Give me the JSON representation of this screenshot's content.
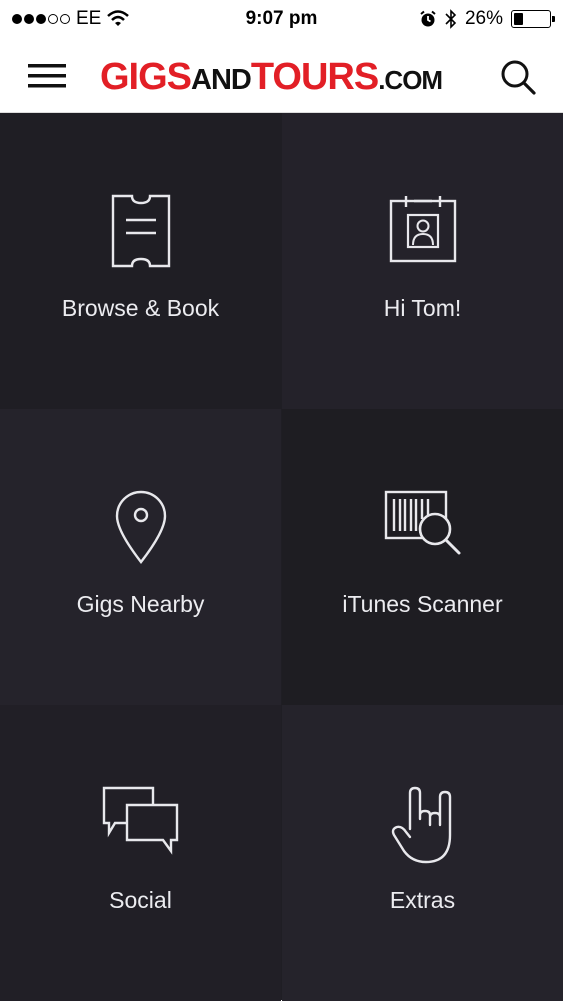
{
  "status_bar": {
    "carrier": "EE",
    "time": "9:07 pm",
    "battery": "26%",
    "battery_level": 0.26,
    "signal_bars_filled": 3,
    "signal_bars_total": 5
  },
  "header": {
    "logo": {
      "part1": "GIGS",
      "part2": "AND",
      "part3": "TOURS",
      "part4": ".COM"
    },
    "brand_color": "#e21f26"
  },
  "tiles": [
    {
      "label": "Browse & Book",
      "icon": "ticket-icon"
    },
    {
      "label": "Hi Tom!",
      "icon": "id-card-icon"
    },
    {
      "label": "Gigs Nearby",
      "icon": "map-pin-icon"
    },
    {
      "label": "iTunes Scanner",
      "icon": "barcode-search-icon"
    },
    {
      "label": "Social",
      "icon": "chat-bubbles-icon"
    },
    {
      "label": "Extras",
      "icon": "rock-hand-icon"
    }
  ],
  "colors": {
    "tile_dark": "#1f1e24",
    "tile_alt": "#25232b",
    "tile_text": "#ececf0"
  }
}
